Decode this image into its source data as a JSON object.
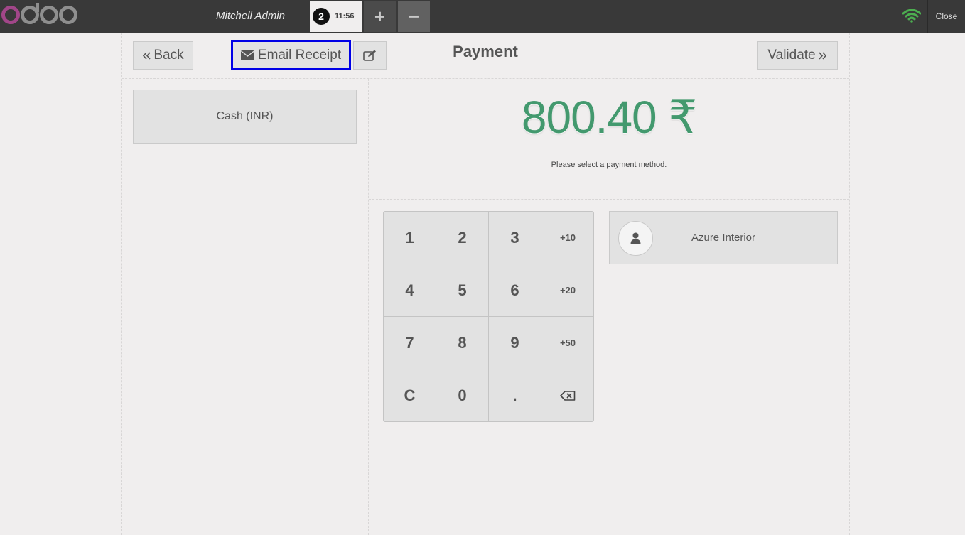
{
  "topbar": {
    "cashier": "Mitchell Admin",
    "order": {
      "sequence": "2",
      "time": "11:56"
    },
    "add_order_label": "+",
    "remove_order_label": "−",
    "close_label": "Close",
    "wifi_color": "#4caf50"
  },
  "header": {
    "back_label": "Back",
    "email_receipt_label": "Email Receipt",
    "title": "Payment",
    "validate_label": "Validate"
  },
  "payment_methods": [
    "Cash (INR)"
  ],
  "summary": {
    "total": "800.40 ₹",
    "message": "Please select a payment method.",
    "total_color": "#43996e"
  },
  "numpad": {
    "keys": [
      "1",
      "2",
      "3",
      "+10",
      "4",
      "5",
      "6",
      "+20",
      "7",
      "8",
      "9",
      "+50",
      "C",
      "0",
      ".",
      "backspace"
    ]
  },
  "customer": {
    "name": "Azure Interior"
  },
  "icons": {
    "back": "double-chevron-left-icon",
    "email": "envelope-icon",
    "edit": "pencil-square-icon",
    "validate": "double-chevron-right-icon",
    "customer": "user-icon",
    "backspace": "backspace-icon",
    "connection": "wifi-icon"
  }
}
